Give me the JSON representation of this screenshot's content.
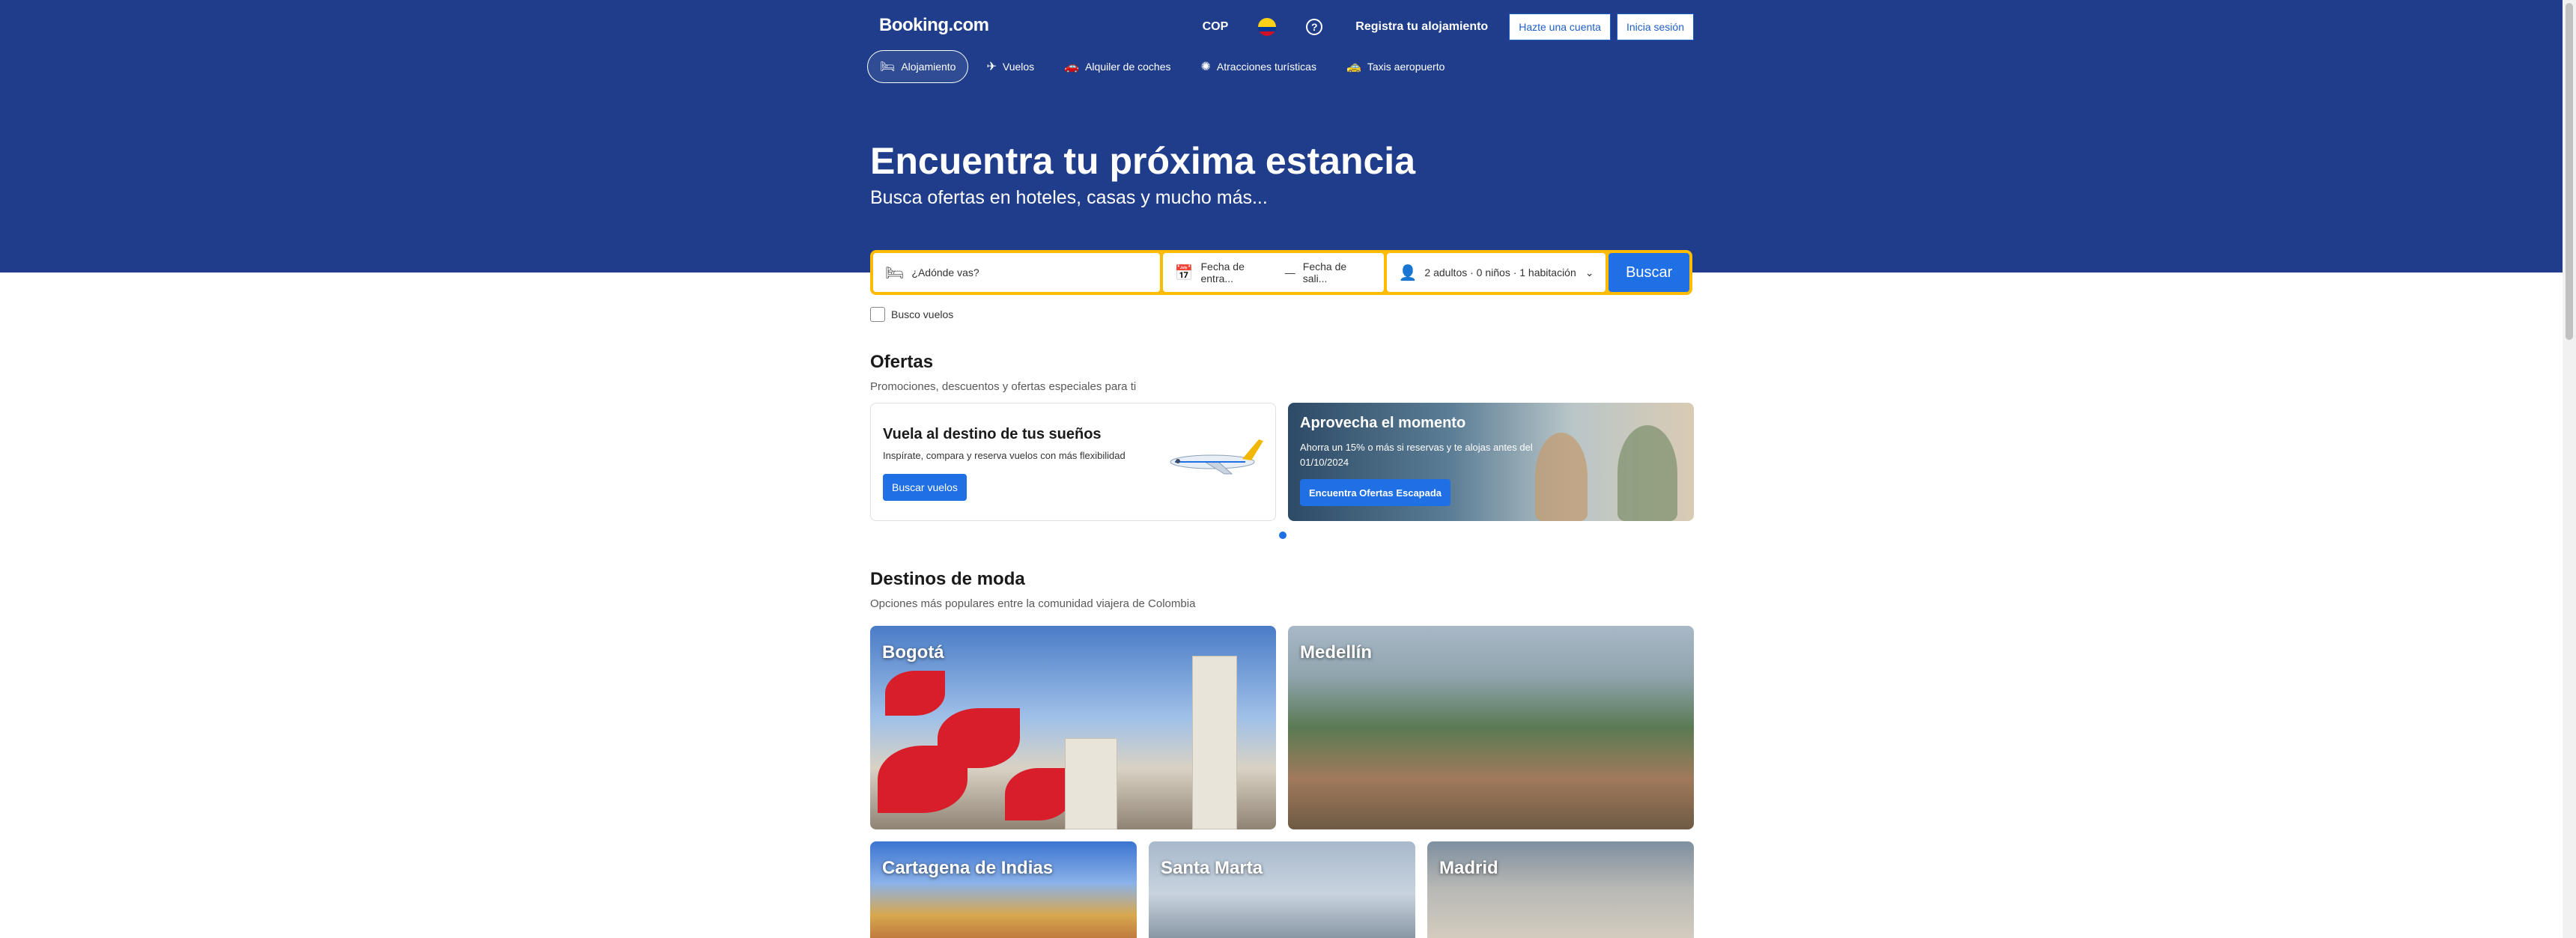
{
  "header": {
    "logo": "Booking.com",
    "currency": "COP",
    "register": "Registra tu alojamiento",
    "signup": "Hazte una cuenta",
    "signin": "Inicia sesión"
  },
  "nav": [
    {
      "label": "Alojamiento",
      "icon": "bed-icon",
      "active": true
    },
    {
      "label": "Vuelos",
      "icon": "plane-icon",
      "active": false
    },
    {
      "label": "Alquiler de coches",
      "icon": "car-icon",
      "active": false
    },
    {
      "label": "Atracciones turísticas",
      "icon": "attractions-icon",
      "active": false
    },
    {
      "label": "Taxis aeropuerto",
      "icon": "taxi-icon",
      "active": false
    }
  ],
  "hero": {
    "title": "Encuentra tu próxima estancia",
    "subtitle": "Busca ofertas en hoteles, casas y mucho más..."
  },
  "search": {
    "destination_placeholder": "¿Adónde vas?",
    "checkin": "Fecha de entra...",
    "separator": "—",
    "checkout": "Fecha de sali...",
    "guests": "2 adultos · 0 niños · 1 habitación",
    "button": "Buscar",
    "flights_checkbox": "Busco vuelos"
  },
  "offers": {
    "title": "Ofertas",
    "subtitle": "Promociones, descuentos y ofertas especiales para ti",
    "card1": {
      "title": "Vuela al destino de tus sueños",
      "text": "Inspírate, compara y reserva vuelos con más flexibilidad",
      "button": "Buscar vuelos"
    },
    "card2": {
      "title": "Aprovecha el momento",
      "text": "Ahorra un 15% o más si reservas y te alojas antes del 01/10/2024",
      "button": "Encuentra Ofertas Escapada"
    }
  },
  "trending": {
    "title": "Destinos de moda",
    "subtitle": "Opciones más populares entre la comunidad viajera de Colombia",
    "destinations": [
      "Bogotá",
      "Medellín",
      "Cartagena de Indias",
      "Santa Marta",
      "Madrid"
    ]
  },
  "colors": {
    "brand_blue": "#1f3d8a",
    "accent_yellow": "#febb02",
    "button_blue": "#1f6fe5"
  }
}
